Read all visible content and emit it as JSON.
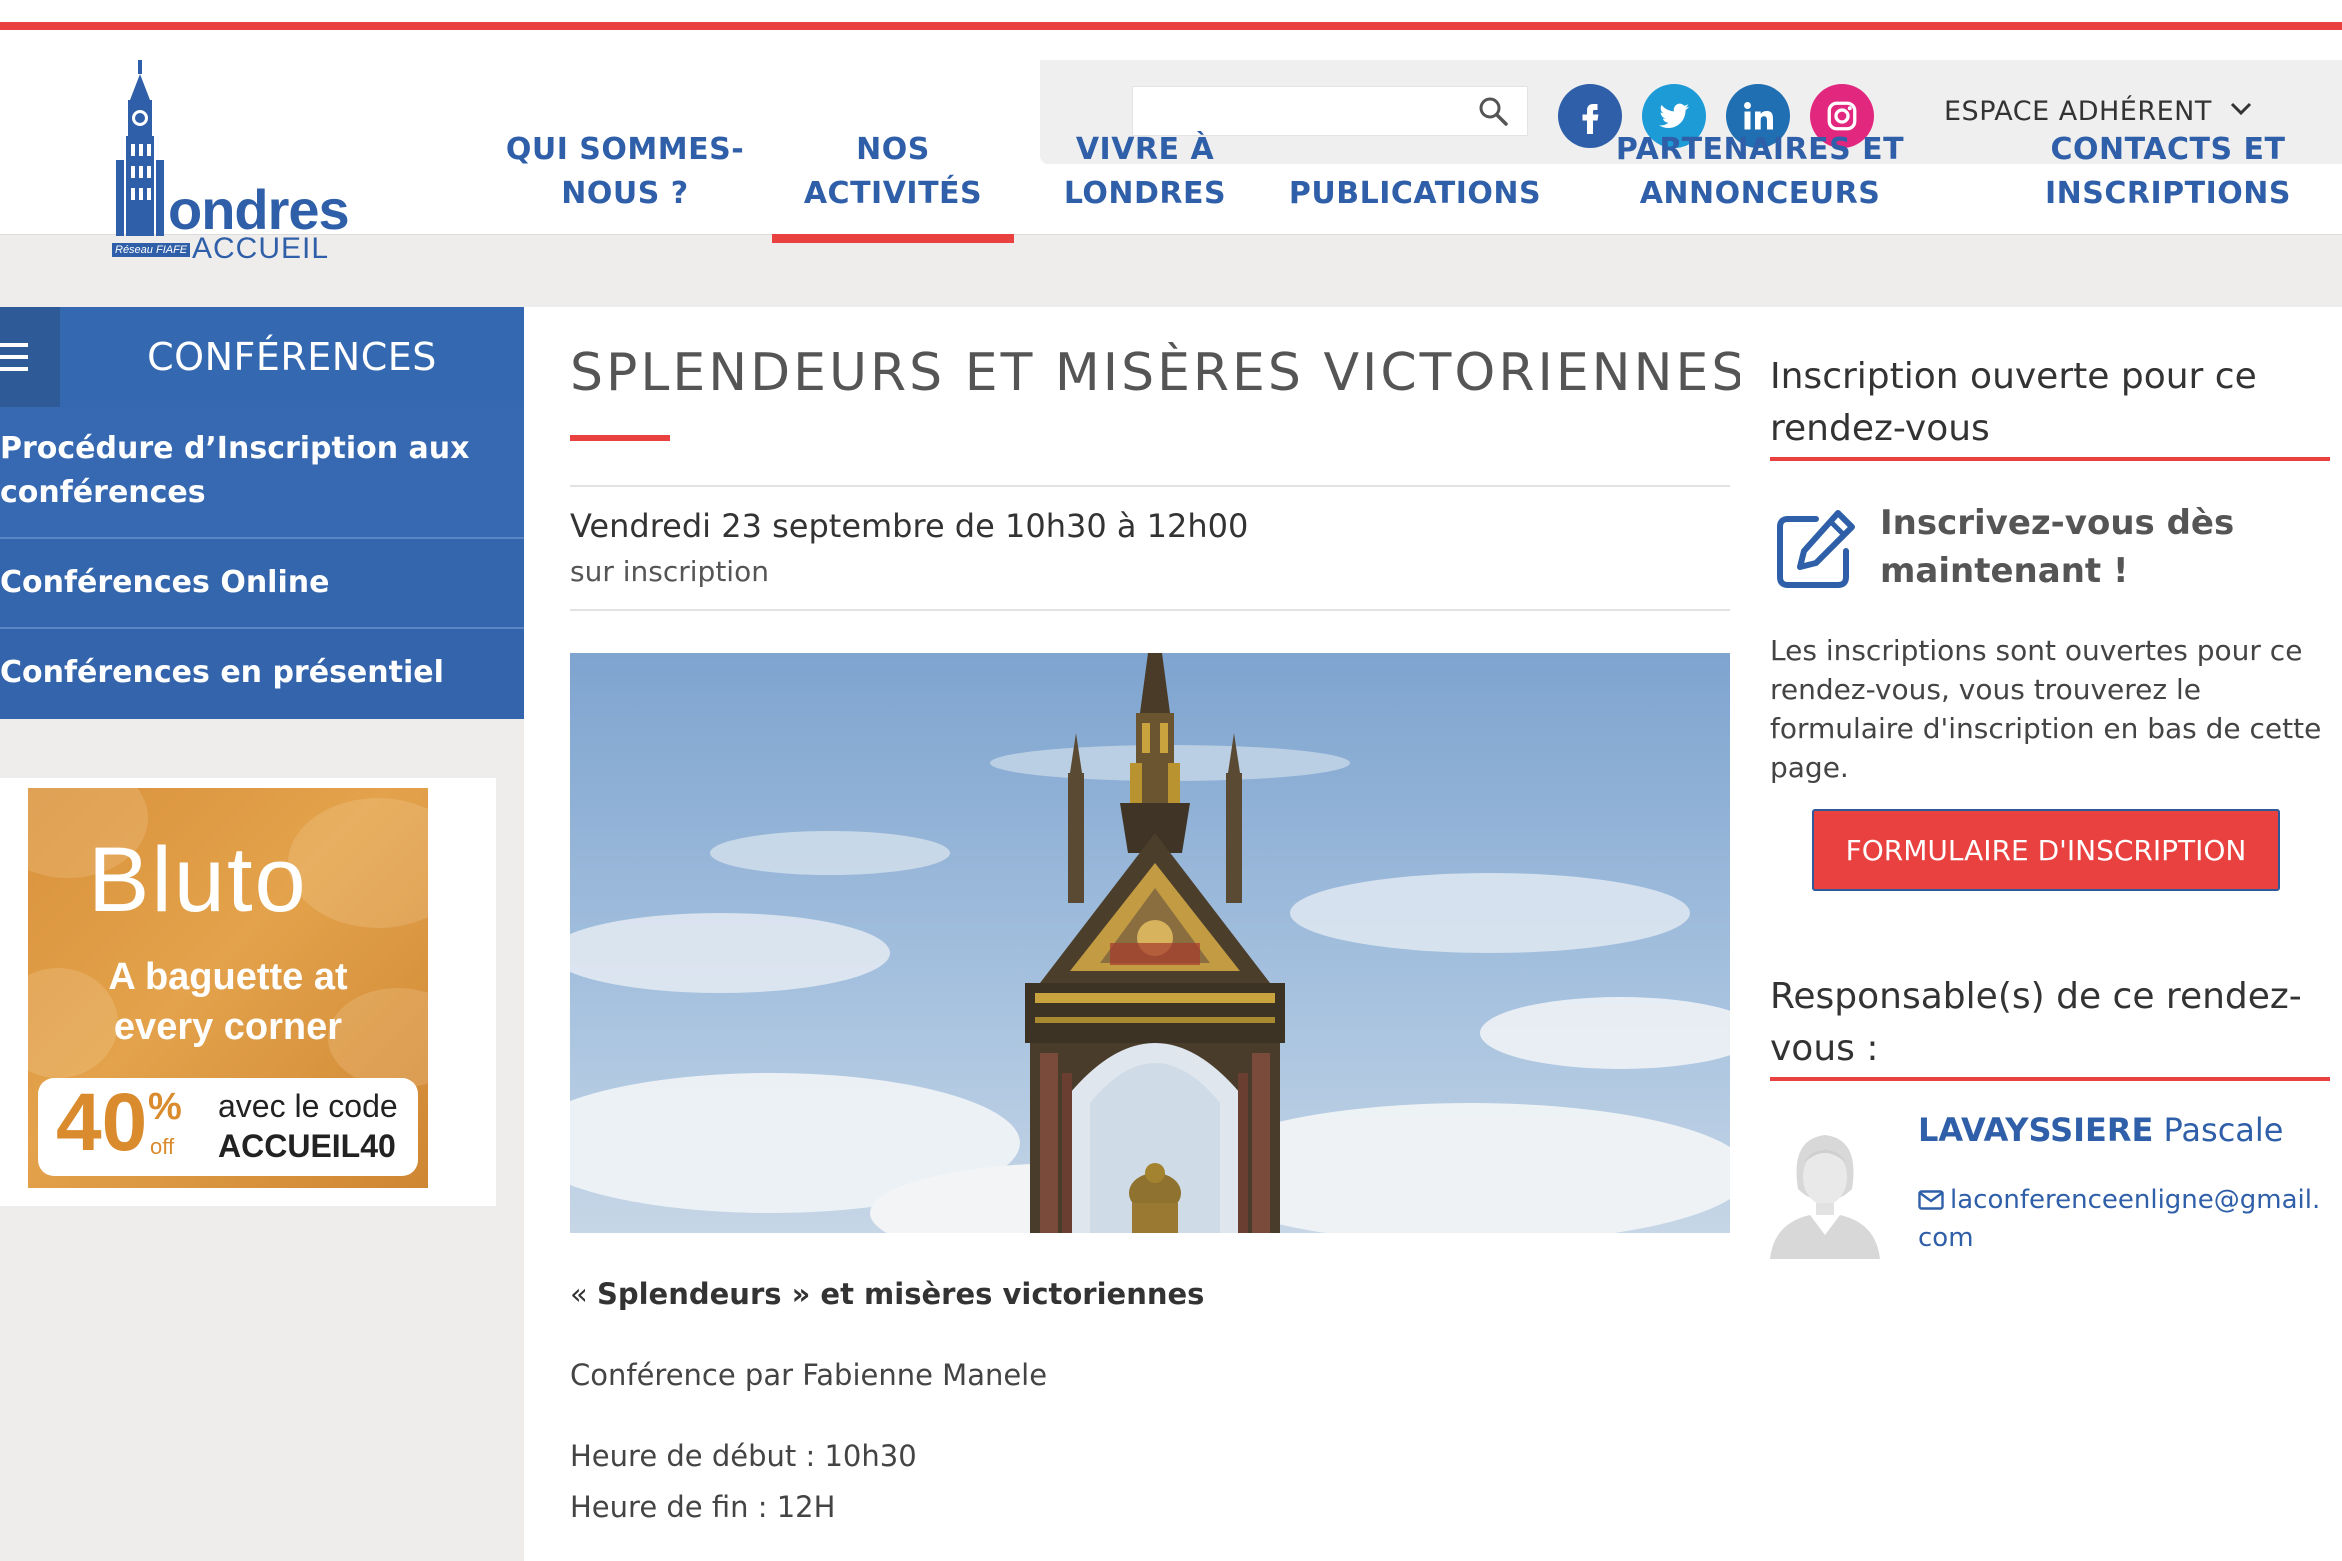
{
  "header": {
    "logo": {
      "brand": "ondres",
      "sub": "ACCUEIL",
      "network": "Réseau FIAFE"
    },
    "search": {
      "placeholder": "",
      "value": ""
    },
    "social": [
      "facebook-icon",
      "twitter-icon",
      "linkedin-icon",
      "instagram-icon"
    ],
    "espace_label": "ESPACE ADHÉRENT",
    "nav": [
      {
        "line1": "QUI SOMMES-",
        "line2": "NOUS ?"
      },
      {
        "line1": "NOS",
        "line2": "ACTIVITÉS"
      },
      {
        "line1": "VIVRE À",
        "line2": "LONDRES"
      },
      {
        "line1": "",
        "line2": "PUBLICATIONS"
      },
      {
        "line1": "PARTENAIRES ET",
        "line2": "ANNONCEURS"
      },
      {
        "line1": "CONTACTS ET",
        "line2": "INSCRIPTIONS"
      }
    ],
    "active_nav_index": 1
  },
  "sidebar": {
    "title": "CONFÉRENCES",
    "items": [
      {
        "label": "Procédure d’Inscription aux conférences"
      },
      {
        "label": "Conférences Online"
      },
      {
        "label": "Conférences en présentiel"
      }
    ]
  },
  "ad": {
    "brand": "Bluto",
    "tagline_1": "A baguette at",
    "tagline_2": "every corner",
    "percent": "40",
    "percent_sign": "%",
    "off": "off",
    "code_line": "avec le code",
    "code": "ACCUEIL40"
  },
  "event": {
    "title": "SPLENDEURS ET MISÈRES VICTORIENNES",
    "date": "Vendredi 23 septembre de 10h30 à 12h00",
    "date_sub": "sur inscription",
    "intro_prefix": "« ",
    "intro_bold": "Splendeurs » et misères victoriennes",
    "speaker": "Conférence par Fabienne Manele",
    "start": "Heure de début : 10h30",
    "end": "Heure de fin : 12H"
  },
  "registration": {
    "heading": "Inscription ouverte pour ce rendez-vous",
    "cta": "Inscrivez-vous dès maintenant !",
    "text": "Les inscriptions sont ouvertes pour ce rendez-vous, vous trouverez le formulaire d'inscription en bas de cette page.",
    "button": "FORMULAIRE D'INSCRIPTION"
  },
  "responsable": {
    "heading": "Responsable(s) de ce rendez-vous :",
    "last_name": "LAVAYSSIERE",
    "first_name": "Pascale",
    "email": "laconferenceenligne@gmail.com"
  },
  "colors": {
    "accent_red": "#e8413f",
    "brand_blue": "#2f5fa8",
    "sidebar_blue": "#3468b0"
  }
}
